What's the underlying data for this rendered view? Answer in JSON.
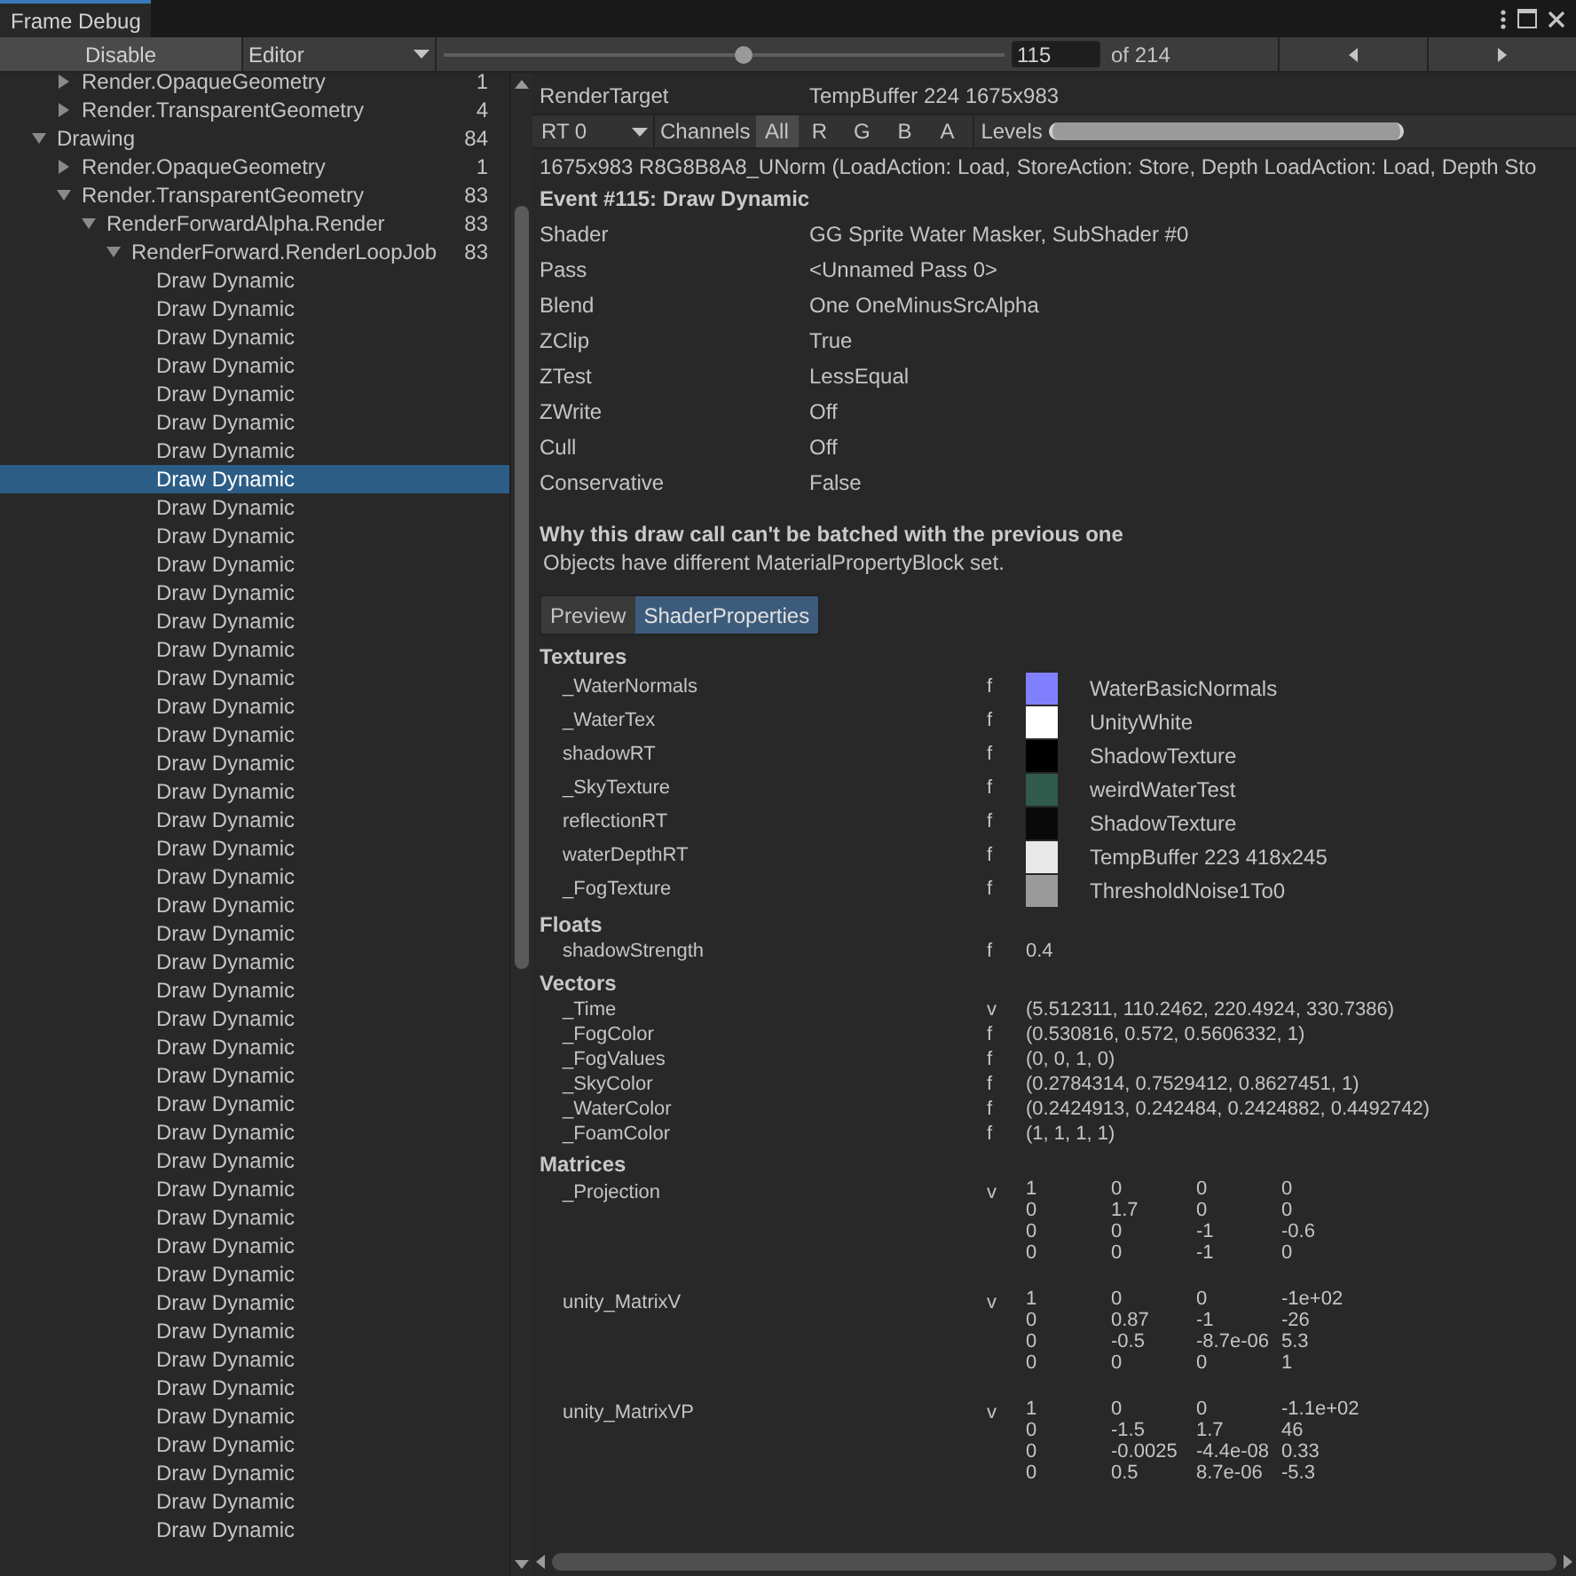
{
  "window": {
    "title": "Frame Debug"
  },
  "toolbar": {
    "disable_button": "Disable",
    "target_dropdown": "Editor",
    "event_slider": {
      "level": 0.535
    },
    "event_index": "115",
    "event_total": "of 214"
  },
  "tree": {
    "scrolled_branch_children": [
      {
        "label": "Render.OpaqueGeometry",
        "count": "1",
        "expanded": false
      },
      {
        "label": "Render.TransparentGeometry",
        "count": "4",
        "expanded": false
      }
    ],
    "items": [
      {
        "label": "Drawing",
        "count": "84",
        "expanded": true,
        "children": [
          {
            "label": "Render.OpaqueGeometry",
            "count": "1",
            "expanded": false
          },
          {
            "label": "Render.TransparentGeometry",
            "count": "83",
            "expanded": true,
            "children": [
              {
                "label": "RenderForwardAlpha.Render",
                "count": "83",
                "expanded": true,
                "children": [
                  {
                    "label": "RenderForward.RenderLoopJob",
                    "count": "83",
                    "expanded": true,
                    "children": [
                      {
                        "label": "Draw Dynamic",
                        "selected": false
                      },
                      {
                        "label": "Draw Dynamic",
                        "selected": false
                      },
                      {
                        "label": "Draw Dynamic",
                        "selected": false
                      },
                      {
                        "label": "Draw Dynamic",
                        "selected": false
                      },
                      {
                        "label": "Draw Dynamic",
                        "selected": false
                      },
                      {
                        "label": "Draw Dynamic",
                        "selected": false
                      },
                      {
                        "label": "Draw Dynamic",
                        "selected": false
                      },
                      {
                        "label": "Draw Dynamic",
                        "selected": true
                      },
                      {
                        "label": "Draw Dynamic",
                        "selected": false
                      },
                      {
                        "label": "Draw Dynamic",
                        "selected": false
                      },
                      {
                        "label": "Draw Dynamic",
                        "selected": false
                      },
                      {
                        "label": "Draw Dynamic",
                        "selected": false
                      },
                      {
                        "label": "Draw Dynamic",
                        "selected": false
                      },
                      {
                        "label": "Draw Dynamic",
                        "selected": false
                      },
                      {
                        "label": "Draw Dynamic",
                        "selected": false
                      },
                      {
                        "label": "Draw Dynamic",
                        "selected": false
                      },
                      {
                        "label": "Draw Dynamic",
                        "selected": false
                      },
                      {
                        "label": "Draw Dynamic",
                        "selected": false
                      },
                      {
                        "label": "Draw Dynamic",
                        "selected": false
                      },
                      {
                        "label": "Draw Dynamic",
                        "selected": false
                      },
                      {
                        "label": "Draw Dynamic",
                        "selected": false
                      },
                      {
                        "label": "Draw Dynamic",
                        "selected": false
                      },
                      {
                        "label": "Draw Dynamic",
                        "selected": false
                      },
                      {
                        "label": "Draw Dynamic",
                        "selected": false
                      },
                      {
                        "label": "Draw Dynamic",
                        "selected": false
                      },
                      {
                        "label": "Draw Dynamic",
                        "selected": false
                      },
                      {
                        "label": "Draw Dynamic",
                        "selected": false
                      },
                      {
                        "label": "Draw Dynamic",
                        "selected": false
                      },
                      {
                        "label": "Draw Dynamic",
                        "selected": false
                      },
                      {
                        "label": "Draw Dynamic",
                        "selected": false
                      },
                      {
                        "label": "Draw Dynamic",
                        "selected": false
                      },
                      {
                        "label": "Draw Dynamic",
                        "selected": false
                      },
                      {
                        "label": "Draw Dynamic",
                        "selected": false
                      },
                      {
                        "label": "Draw Dynamic",
                        "selected": false
                      },
                      {
                        "label": "Draw Dynamic",
                        "selected": false
                      },
                      {
                        "label": "Draw Dynamic",
                        "selected": false
                      },
                      {
                        "label": "Draw Dynamic",
                        "selected": false
                      },
                      {
                        "label": "Draw Dynamic",
                        "selected": false
                      },
                      {
                        "label": "Draw Dynamic",
                        "selected": false
                      },
                      {
                        "label": "Draw Dynamic",
                        "selected": false
                      },
                      {
                        "label": "Draw Dynamic",
                        "selected": false
                      },
                      {
                        "label": "Draw Dynamic",
                        "selected": false
                      },
                      {
                        "label": "Draw Dynamic",
                        "selected": false
                      },
                      {
                        "label": "Draw Dynamic",
                        "selected": false
                      },
                      {
                        "label": "Draw Dynamic",
                        "selected": false
                      }
                    ]
                  }
                ]
              }
            ]
          }
        ]
      }
    ]
  },
  "details": {
    "render_target": {
      "label": "RenderTarget",
      "value": "TempBuffer 224 1675x983"
    },
    "rt_dropdown": "RT 0",
    "channels_label": "Channels",
    "channels": [
      {
        "label": "All",
        "selected": true
      },
      {
        "label": "R",
        "selected": false
      },
      {
        "label": "G",
        "selected": false
      },
      {
        "label": "B",
        "selected": false
      },
      {
        "label": "A",
        "selected": false
      }
    ],
    "levels": {
      "label": "Levels",
      "level": 1
    },
    "format_line": "1675x983 R8G8B8A8_UNorm (LoadAction: Load, StoreAction: Store, Depth LoadAction: Load, Depth Sto",
    "event_title": "Event #115: Draw Dynamic",
    "properties": [
      {
        "name": "Shader",
        "value": "GG Sprite Water Masker, SubShader #0"
      },
      {
        "name": "Pass",
        "value": "<Unnamed Pass 0>"
      },
      {
        "name": "Blend",
        "value": "One OneMinusSrcAlpha"
      },
      {
        "name": "ZClip",
        "value": "True"
      },
      {
        "name": "ZTest",
        "value": "LessEqual"
      },
      {
        "name": "ZWrite",
        "value": "Off"
      },
      {
        "name": "Cull",
        "value": "Off"
      },
      {
        "name": "Conservative",
        "value": "False"
      }
    ],
    "batch_heading": "Why this draw call can't be batched with the previous one",
    "batch_reason": "Objects have different MaterialPropertyBlock set.",
    "tabs": [
      {
        "label": "Preview",
        "selected": false
      },
      {
        "label": "ShaderProperties",
        "selected": true
      }
    ],
    "textures": {
      "heading": "Textures",
      "items": [
        {
          "name": "_WaterNormals",
          "type": "f",
          "color": "#8080ff",
          "value": "WaterBasicNormals"
        },
        {
          "name": "_WaterTex",
          "type": "f",
          "color": "#ffffff",
          "value": "UnityWhite"
        },
        {
          "name": "shadowRT",
          "type": "f",
          "color": "#000000",
          "value": "ShadowTexture"
        },
        {
          "name": "_SkyTexture",
          "type": "f",
          "color": "#2f5a4c",
          "value": "weirdWaterTest"
        },
        {
          "name": "reflectionRT",
          "type": "f",
          "color": "#0a0a0a",
          "value": "ShadowTexture"
        },
        {
          "name": "waterDepthRT",
          "type": "f",
          "color": "#e8e8e8",
          "value": "TempBuffer 223 418x245"
        },
        {
          "name": "_FogTexture",
          "type": "f",
          "color": "#9a9a9a",
          "value": "ThresholdNoise1To0"
        }
      ]
    },
    "floats": {
      "heading": "Floats",
      "items": [
        {
          "name": "shadowStrength",
          "type": "f",
          "value": "0.4"
        }
      ]
    },
    "vectors": {
      "heading": "Vectors",
      "items": [
        {
          "name": "_Time",
          "type": "v",
          "value": "(5.512311, 110.2462, 220.4924, 330.7386)"
        },
        {
          "name": "_FogColor",
          "type": "f",
          "value": "(0.530816, 0.572, 0.5606332, 1)"
        },
        {
          "name": "_FogValues",
          "type": "f",
          "value": "(0, 0, 1, 0)"
        },
        {
          "name": "_SkyColor",
          "type": "f",
          "value": "(0.2784314, 0.7529412, 0.8627451, 1)"
        },
        {
          "name": "_WaterColor",
          "type": "f",
          "value": "(0.2424913, 0.242484, 0.2424882, 0.4492742)"
        },
        {
          "name": "_FoamColor",
          "type": "f",
          "value": "(1, 1, 1, 1)"
        }
      ]
    },
    "matrices": {
      "heading": "Matrices",
      "items": [
        {
          "name": "_Projection",
          "type": "v",
          "rows": [
            [
              "1",
              "0",
              "0",
              "0"
            ],
            [
              "0",
              "1.7",
              "0",
              "0"
            ],
            [
              "0",
              "0",
              "-1",
              "-0.6"
            ],
            [
              "0",
              "0",
              "-1",
              "0"
            ]
          ]
        },
        {
          "name": "unity_MatrixV",
          "type": "v",
          "rows": [
            [
              "1",
              "0",
              "0",
              "-1e+02"
            ],
            [
              "0",
              "0.87",
              "-1",
              "-26"
            ],
            [
              "0",
              "-0.5",
              "-8.7e-06",
              "5.3"
            ],
            [
              "0",
              "0",
              "0",
              "1"
            ]
          ]
        },
        {
          "name": "unity_MatrixVP",
          "type": "v",
          "rows": [
            [
              "1",
              "0",
              "0",
              "-1.1e+02"
            ],
            [
              "0",
              "-1.5",
              "1.7",
              "46"
            ],
            [
              "0",
              "-0.0025",
              "-4.4e-08",
              "0.33"
            ],
            [
              "0",
              "0.5",
              "8.7e-06",
              "-5.3"
            ]
          ]
        }
      ]
    }
  }
}
